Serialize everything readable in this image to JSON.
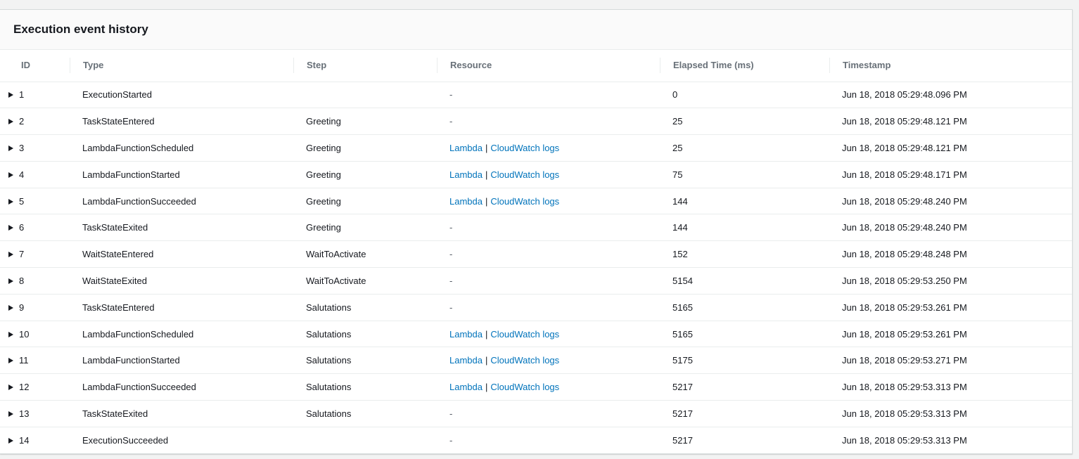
{
  "panel": {
    "title": "Execution event history"
  },
  "columns": {
    "id": "ID",
    "type": "Type",
    "step": "Step",
    "resource": "Resource",
    "elapsed": "Elapsed Time (ms)",
    "timestamp": "Timestamp"
  },
  "resource_links": {
    "lambda": "Lambda",
    "separator": "|",
    "logs": "CloudWatch logs",
    "none": "-"
  },
  "rows": [
    {
      "id": "1",
      "type": "ExecutionStarted",
      "step": "",
      "resource": "none",
      "elapsed": "0",
      "timestamp": "Jun 18, 2018 05:29:48.096 PM"
    },
    {
      "id": "2",
      "type": "TaskStateEntered",
      "step": "Greeting",
      "resource": "none",
      "elapsed": "25",
      "timestamp": "Jun 18, 2018 05:29:48.121 PM"
    },
    {
      "id": "3",
      "type": "LambdaFunctionScheduled",
      "step": "Greeting",
      "resource": "links",
      "elapsed": "25",
      "timestamp": "Jun 18, 2018 05:29:48.121 PM"
    },
    {
      "id": "4",
      "type": "LambdaFunctionStarted",
      "step": "Greeting",
      "resource": "links",
      "elapsed": "75",
      "timestamp": "Jun 18, 2018 05:29:48.171 PM"
    },
    {
      "id": "5",
      "type": "LambdaFunctionSucceeded",
      "step": "Greeting",
      "resource": "links",
      "elapsed": "144",
      "timestamp": "Jun 18, 2018 05:29:48.240 PM"
    },
    {
      "id": "6",
      "type": "TaskStateExited",
      "step": "Greeting",
      "resource": "none",
      "elapsed": "144",
      "timestamp": "Jun 18, 2018 05:29:48.240 PM"
    },
    {
      "id": "7",
      "type": "WaitStateEntered",
      "step": "WaitToActivate",
      "resource": "none",
      "elapsed": "152",
      "timestamp": "Jun 18, 2018 05:29:48.248 PM"
    },
    {
      "id": "8",
      "type": "WaitStateExited",
      "step": "WaitToActivate",
      "resource": "none",
      "elapsed": "5154",
      "timestamp": "Jun 18, 2018 05:29:53.250 PM"
    },
    {
      "id": "9",
      "type": "TaskStateEntered",
      "step": "Salutations",
      "resource": "none",
      "elapsed": "5165",
      "timestamp": "Jun 18, 2018 05:29:53.261 PM"
    },
    {
      "id": "10",
      "type": "LambdaFunctionScheduled",
      "step": "Salutations",
      "resource": "links",
      "elapsed": "5165",
      "timestamp": "Jun 18, 2018 05:29:53.261 PM"
    },
    {
      "id": "11",
      "type": "LambdaFunctionStarted",
      "step": "Salutations",
      "resource": "links",
      "elapsed": "5175",
      "timestamp": "Jun 18, 2018 05:29:53.271 PM"
    },
    {
      "id": "12",
      "type": "LambdaFunctionSucceeded",
      "step": "Salutations",
      "resource": "links",
      "elapsed": "5217",
      "timestamp": "Jun 18, 2018 05:29:53.313 PM"
    },
    {
      "id": "13",
      "type": "TaskStateExited",
      "step": "Salutations",
      "resource": "none",
      "elapsed": "5217",
      "timestamp": "Jun 18, 2018 05:29:53.313 PM"
    },
    {
      "id": "14",
      "type": "ExecutionSucceeded",
      "step": "",
      "resource": "none",
      "elapsed": "5217",
      "timestamp": "Jun 18, 2018 05:29:53.313 PM"
    }
  ],
  "colors": {
    "link": "#0073bb",
    "text": "#16191f",
    "header_text": "#687078",
    "divider": "#eaeded"
  },
  "icons": {
    "row_toggle": "caret-right-icon"
  }
}
